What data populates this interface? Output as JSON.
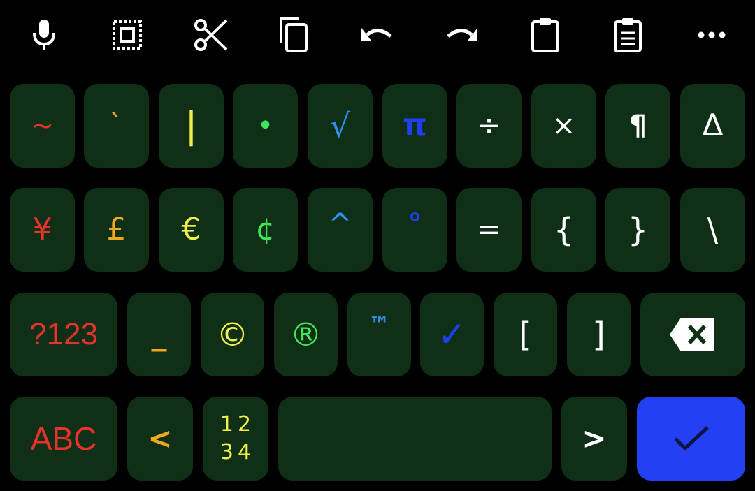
{
  "toolbar": {
    "icons": [
      "microphone-icon",
      "select-all-icon",
      "cut-icon",
      "copy-icon",
      "undo-icon",
      "redo-icon",
      "clipboard-icon",
      "clipboard-list-icon",
      "more-options-icon"
    ],
    "color": "#ffffff"
  },
  "keyboard": {
    "key_color": "#0f3017",
    "enter_color": "#2440f5",
    "row1": [
      {
        "label": "~",
        "color": "#e8332c"
      },
      {
        "label": "`",
        "color": "#f0a820"
      },
      {
        "label": "|",
        "color": "#f2ee4a"
      },
      {
        "label": "•",
        "color": "#3ee45a"
      },
      {
        "label": "√",
        "color": "#2f8fef"
      },
      {
        "label": "π",
        "color": "#1f3ff2"
      },
      {
        "label": "÷",
        "color": "#ffffff"
      },
      {
        "label": "×",
        "color": "#ffffff"
      },
      {
        "label": "¶",
        "color": "#ffffff"
      },
      {
        "label": "∆",
        "color": "#ffffff"
      }
    ],
    "row2": [
      {
        "label": "¥",
        "color": "#e8332c"
      },
      {
        "label": "£",
        "color": "#f0a820"
      },
      {
        "label": "€",
        "color": "#f2ee4a"
      },
      {
        "label": "¢",
        "color": "#3ee45a"
      },
      {
        "label": "^",
        "color": "#2f8fef"
      },
      {
        "label": "°",
        "color": "#1f3ff2"
      },
      {
        "label": "=",
        "color": "#ffffff"
      },
      {
        "label": "{",
        "color": "#ffffff"
      },
      {
        "label": "}",
        "color": "#ffffff"
      },
      {
        "label": "\\",
        "color": "#ffffff"
      }
    ],
    "row3": [
      {
        "label": "?123",
        "color": "#e8332c"
      },
      {
        "label": "_",
        "color": "#f0a820"
      },
      {
        "label": "©",
        "color": "#f2ee4a"
      },
      {
        "label": "®",
        "color": "#3ee45a"
      },
      {
        "label": "™",
        "color": "#2f8fef"
      },
      {
        "label": "✓",
        "color": "#1f3ff2"
      },
      {
        "label": "[",
        "color": "#ffffff"
      },
      {
        "label": "]",
        "color": "#ffffff"
      }
    ],
    "backspace_icon": "backspace-icon",
    "row4": {
      "abc": {
        "label": "ABC",
        "color": "#e8332c"
      },
      "less": {
        "label": "<",
        "color": "#f0a820"
      },
      "numpad_line1": "12",
      "numpad_line2": "34",
      "numpad_color": "#f2ee4a",
      "space": "",
      "greater": {
        "label": ">",
        "color": "#ffffff"
      },
      "enter_icon": "checkmark-icon"
    }
  }
}
